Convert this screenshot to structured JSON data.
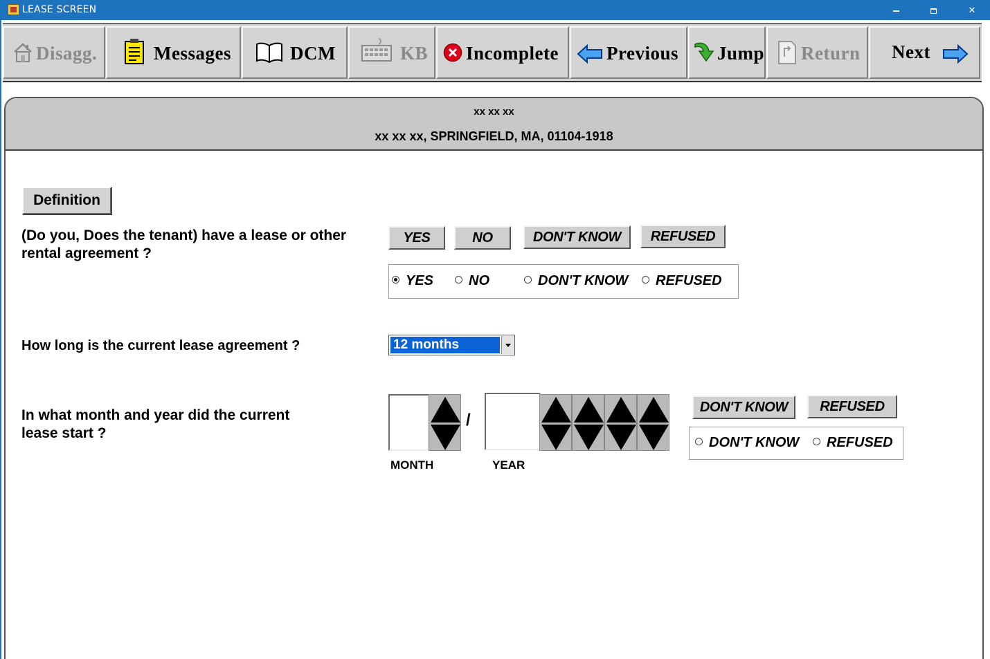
{
  "window": {
    "title": "LEASE SCREEN"
  },
  "toolbar": {
    "disagg": "Disagg.",
    "messages": "Messages",
    "dcm": "DCM",
    "kb": "KB",
    "incomplete": "Incomplete",
    "previous": "Previous",
    "jump": "Jump",
    "return": "Return",
    "next": "Next"
  },
  "header": {
    "line1": "xx xx xx",
    "line2": "xx xx xx, SPRINGFIELD, MA, 01104-1918"
  },
  "definition_label": "Definition",
  "q1": {
    "text": "(Do you, Does the tenant) have a lease or other rental agreement ?",
    "buttons": {
      "yes": "YES",
      "no": "NO",
      "dont_know": "DON'T KNOW",
      "refused": "REFUSED"
    },
    "radios": {
      "yes": "YES",
      "no": "NO",
      "dont_know": "DON'T KNOW",
      "refused": "REFUSED"
    },
    "selected": "yes"
  },
  "q2": {
    "text": "How long is the current lease agreement ?",
    "selected_value": "12 months"
  },
  "q3": {
    "text": "In what month and year did the current lease start ?",
    "separator": "/",
    "month_label": "MONTH",
    "year_label": "YEAR",
    "buttons": {
      "dont_know": "DON'T KNOW",
      "refused": "REFUSED"
    },
    "radios": {
      "dont_know": "DON'T KNOW",
      "refused": "REFUSED"
    }
  },
  "colors": {
    "titlebar": "#1e73be",
    "selection": "#0a64d8",
    "panel_header": "#c8c8c8"
  }
}
